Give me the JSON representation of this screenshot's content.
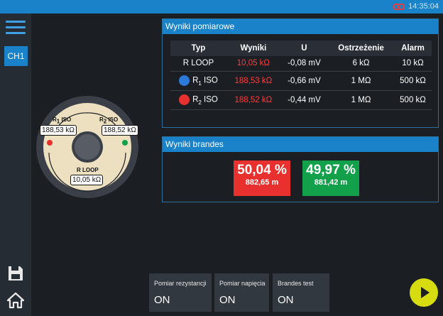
{
  "topbar": {
    "time": "14:35:04",
    "alarm_icon": "alarm-battery-icon"
  },
  "sidebar": {
    "channel": "CH1",
    "menu_icon": "hamburger-menu-icon",
    "save_icon": "save-icon",
    "home_icon": "home-icon"
  },
  "results": {
    "title": "Wyniki pomiarowe",
    "headers": [
      "Typ",
      "Wyniki",
      "U",
      "Ostrzeżenie",
      "Alarm"
    ],
    "rows": [
      {
        "typ": "R LOOP",
        "wyniki": "10,05 kΩ",
        "u": "-0,08 mV",
        "warn": "6 kΩ",
        "alarm": "10 kΩ"
      },
      {
        "typ_prefix": "R",
        "typ_sub": "1",
        "typ_suffix": " ISO",
        "wyniki": "188,53 kΩ",
        "u": "-0,66 mV",
        "warn": "1 MΩ",
        "alarm": "500 kΩ"
      },
      {
        "typ_prefix": "R",
        "typ_sub": "2",
        "typ_suffix": " ISO",
        "wyniki": "188,52 kΩ",
        "u": "-0,44 mV",
        "warn": "1 MΩ",
        "alarm": "500 kΩ"
      }
    ]
  },
  "brandes": {
    "title": "Wyniki brandes",
    "left": {
      "percent": "50,04 %",
      "meters": "882,65 m",
      "color": "#e8312f"
    },
    "right": {
      "percent": "49,97 %",
      "meters": "881,42 m",
      "color": "#12a04a"
    }
  },
  "diagram": {
    "r1_label_prefix": "R",
    "r1_label_sub": "1",
    "r1_label_suffix": " ISO",
    "r1_value": "188,53 kΩ",
    "r2_label_prefix": "R",
    "r2_label_sub": "2",
    "r2_label_suffix": " ISO",
    "r2_value": "188,52 kΩ",
    "loop_label": "R LOOP",
    "loop_value": "10,05 kΩ"
  },
  "tiles": [
    {
      "label": "Pomiar rezystancji",
      "value": "ON"
    },
    {
      "label": "Pomiar napięcia",
      "value": "ON"
    },
    {
      "label": "Brandes test",
      "value": "ON"
    }
  ],
  "play_icon": "play-icon"
}
